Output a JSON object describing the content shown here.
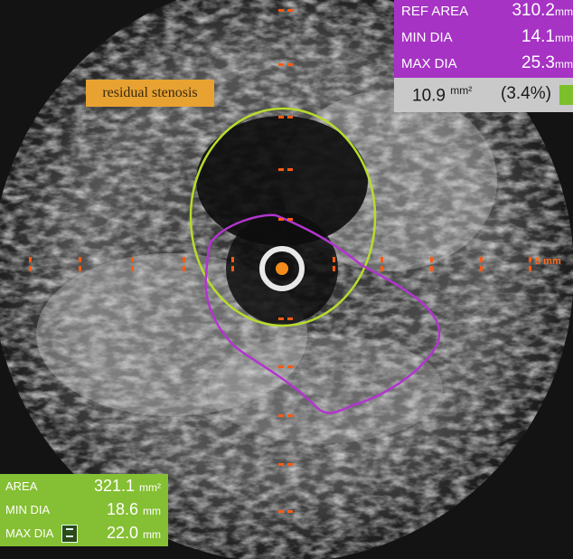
{
  "image_description_free": true,
  "reference_panel": {
    "ref_area": {
      "label": "REF AREA",
      "value": "310.2",
      "unit": "mm"
    },
    "min_dia": {
      "label": "MIN DIA",
      "value": "14.1",
      "unit": "mm"
    },
    "max_dia": {
      "label": "MAX DIA",
      "value": "25.3",
      "unit": "mm"
    }
  },
  "percent_panel": {
    "area_value": "10.9",
    "area_unit": "mm²",
    "percent": "(3.4%)"
  },
  "annotation": {
    "label": "residual stenosis"
  },
  "lumen_panel": {
    "area": {
      "label": "AREA",
      "value": "321.1",
      "unit": "mm²"
    },
    "min_dia": {
      "label": "MIN DIA",
      "value": "18.6",
      "unit": "mm"
    },
    "max_dia": {
      "label": "MAX DIA",
      "value": "22.0",
      "unit": "mm"
    }
  },
  "scale": {
    "label": "5 mm"
  },
  "colors": {
    "reference_contour": "#b7dc2c",
    "stenosis_contour": "#b235cf",
    "markers": "#ff5a12",
    "ref_panel": "#a633c4",
    "lumen_panel": "#85bf33",
    "annotation_bg": "#e8a232"
  }
}
